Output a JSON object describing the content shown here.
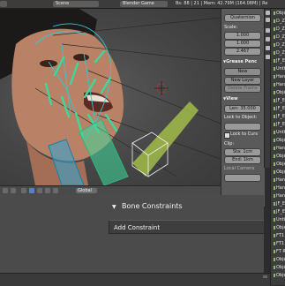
{
  "header": {
    "scene_label": "Scene",
    "engine_label": "Blender Game",
    "stats": "Bs: 88 | 21 | Mem: 42.79M (164.08M) | Re"
  },
  "npanel": {
    "rotation_mode": "Quaternion",
    "scale_label": "Scale:",
    "scale_values": [
      "1.000",
      "1.000",
      "2.467"
    ],
    "grease_pencil_header": "Grease Penc",
    "new_button": "New",
    "new_layer_button": "New Layer",
    "delete_frame_button": "Delete Frame",
    "view_header": "View",
    "lens_value": "Len: 35.000",
    "lock_to_object_label": "Lock to Object:",
    "lock_to_cursor_label": "Lock to Curs",
    "clip_label": "Clip:",
    "clip_start": "Sta: 1cm",
    "clip_end": "End: 1km",
    "local_camera_label": "Local Camera"
  },
  "outliner": {
    "rows": [
      "Object",
      "D_Z",
      "D_Z",
      "D_Z",
      "D_Z",
      "D_Z",
      "JF_E",
      "Unti",
      "Hand",
      "Hand",
      "Obje",
      "JF_E",
      "JF_E",
      "JF_E",
      "JF_E",
      "Unti",
      "Obje",
      "Hand",
      "Obje",
      "Obje",
      "Obje",
      "Hand",
      "Hand",
      "Hand",
      "JF_E",
      "JF_E",
      "Unti",
      "Obje",
      "FT1",
      "FT1",
      "FT R",
      "Obje",
      "Obje",
      "Obje"
    ]
  },
  "viewport_header": {
    "orientation": "Global",
    "tool_icons": [
      "pivot-icon",
      "object-origin-icon",
      "manipulator-icon",
      "translate-icon",
      "rotate-icon",
      "scale-icon"
    ]
  },
  "constraints_panel": {
    "title": "Bone Constraints",
    "add_button": "Add Constraint"
  },
  "colors": {
    "bone_green": "#3ed89a",
    "bone_cyan": "#37c6d0",
    "viewport_bg": "#4c4c4c",
    "active_blue": "#5680c2"
  }
}
